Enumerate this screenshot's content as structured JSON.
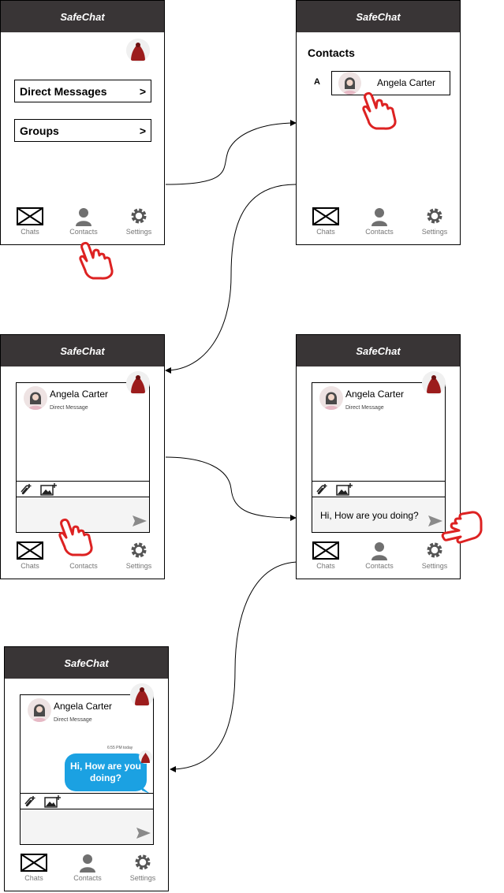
{
  "app": {
    "title": "SafeChat"
  },
  "nav": {
    "chats": "Chats",
    "contacts": "Contacts",
    "settings": "Settings"
  },
  "screen1": {
    "direct_messages": "Direct Messages",
    "groups": "Groups",
    "arrow": ">"
  },
  "screen2": {
    "contacts_title": "Contacts",
    "letter": "A",
    "contact_name": "Angela Carter"
  },
  "chat": {
    "contact_name": "Angela Carter",
    "subtitle": "Direct Message"
  },
  "screen4": {
    "typed_message": "Hi, How are you doing?"
  },
  "screen5": {
    "timestamp": "6:55 PM today",
    "sent_message": "Hi, How are you doing?"
  },
  "colors": {
    "header": "#393536",
    "bubble": "#1ba1e2",
    "hand": "#dd2222",
    "avatar_red": "#9c1c1c"
  }
}
